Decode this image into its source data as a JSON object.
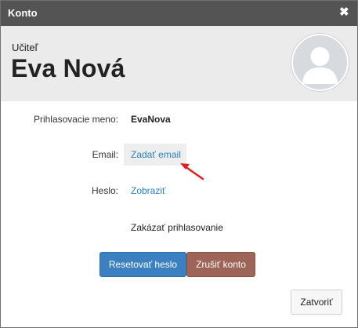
{
  "dialog": {
    "title": "Konto",
    "close_icon": "close-icon"
  },
  "profile": {
    "role": "Učiteľ",
    "name": "Eva Nová",
    "avatar_icon": "user-silhouette-icon"
  },
  "fields": {
    "username_label": "Prihlasovacie meno:",
    "username_value": "EvaNova",
    "email_label": "Email:",
    "email_link": "Zadať email",
    "password_label": "Heslo:",
    "password_link": "Zobraziť",
    "disable_login": "Zakázať prihlasovanie"
  },
  "buttons": {
    "reset_password": "Resetovať heslo",
    "cancel_account": "Zrušiť konto",
    "close": "Zatvoriť"
  },
  "colors": {
    "titlebar": "#545454",
    "header_bg": "#ebebeb",
    "link": "#2a7fc1",
    "primary_button": "#3b81c2",
    "danger_button": "#9e6457",
    "annotation_arrow": "#e02020"
  }
}
